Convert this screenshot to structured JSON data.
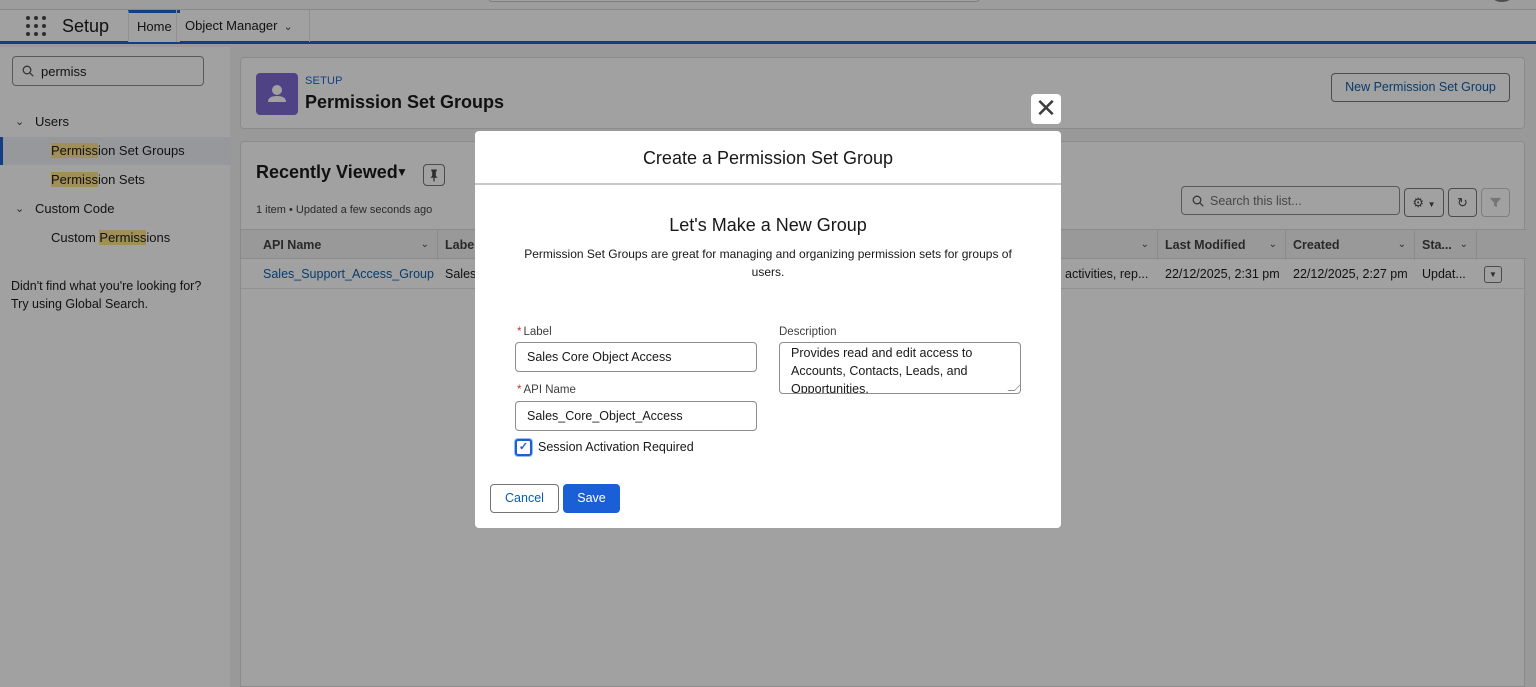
{
  "nav": {
    "app_name": "Setup",
    "tabs": [
      {
        "label": "Home"
      },
      {
        "label": "Object Manager"
      }
    ]
  },
  "sidebar": {
    "quick_find": {
      "value": "permiss"
    },
    "groups": [
      {
        "label": "Users",
        "items": [
          {
            "hl": "Permiss",
            "rest": "ion Set Groups",
            "selected": true
          },
          {
            "hl": "Permiss",
            "rest": "ion Sets"
          }
        ]
      },
      {
        "label": "Custom Code",
        "items": [
          {
            "pre": "Custom ",
            "hl": "Permiss",
            "rest": "ions"
          }
        ]
      }
    ],
    "not_found_line1": "Didn't find what you're looking for?",
    "not_found_line2": "Try using Global Search."
  },
  "header": {
    "eyebrow": "SETUP",
    "title": "Permission Set Groups",
    "new_button": "New Permission Set Group",
    "icon": "user-icon"
  },
  "list_view": {
    "title": "Recently Viewed",
    "meta": "1 item • Updated a few seconds ago",
    "search_placeholder": "Search this list...",
    "columns": [
      {
        "label": "API Name"
      },
      {
        "label": "Label"
      },
      {
        "label": ""
      },
      {
        "label": "Last Modified"
      },
      {
        "label": "Created"
      },
      {
        "label": "Sta..."
      }
    ],
    "rows": [
      {
        "api_name": "Sales_Support_Access_Group",
        "label": "Sales",
        "description": "activities, rep...",
        "last_modified": "22/12/2025, 2:31 pm",
        "created": "22/12/2025, 2:27 pm",
        "status": "Updat..."
      }
    ]
  },
  "modal": {
    "title": "Create a Permission Set Group",
    "subtitle": "Let's Make a New Group",
    "description_line1": "Permission Set Groups are great for managing and organizing permission sets for groups of",
    "description_line2": "users.",
    "fields": {
      "label": {
        "label": "Label",
        "value": "Sales Core Object Access",
        "required": true
      },
      "api_name": {
        "label": "API Name",
        "value": "Sales_Core_Object_Access",
        "required": true
      },
      "description": {
        "label": "Description",
        "value": "Provides read and edit access to Accounts, Contacts, Leads, and Opportunities."
      }
    },
    "session_activation": {
      "label": "Session Activation Required",
      "checked": true
    },
    "cancel": "Cancel",
    "save": "Save"
  },
  "colors": {
    "brand": "#1b5fd6",
    "link": "#0b5cab",
    "header_icon_bg": "#7b68d4",
    "highlight": "#fde38a"
  }
}
